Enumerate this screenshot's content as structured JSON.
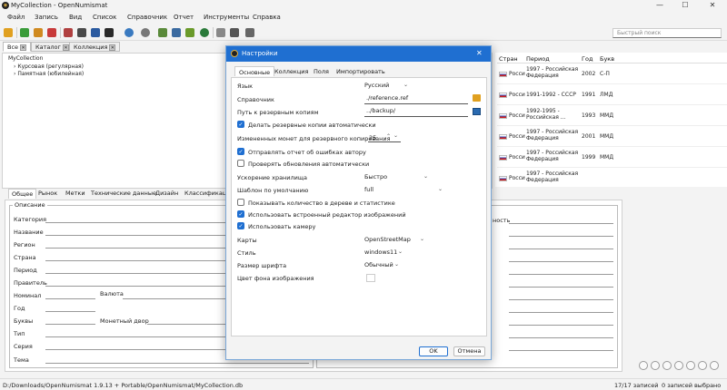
{
  "window": {
    "title": "MyCollection - OpenNumismat"
  },
  "menu": [
    "Файл",
    "Запись",
    "Вид",
    "Список",
    "Справочник",
    "Отчет",
    "Инструменты",
    "Справка"
  ],
  "quick_search_placeholder": "Быстрый поиск",
  "top_tabs": [
    "Все",
    "Каталог",
    "Коллекция"
  ],
  "tree": {
    "root": "MyCollection",
    "children": [
      "Курсовая (регулярная)",
      "Памятная (юбилейная)"
    ]
  },
  "grid": {
    "columns": [
      "Стран",
      "Период",
      "Год",
      "Букв"
    ],
    "rows": [
      {
        "country": "Росси",
        "period": "1997 - Российская Федерация",
        "year": "2002",
        "mint": "С-П"
      },
      {
        "country": "Росси",
        "period": "1991-1992 - СССР",
        "year": "1991",
        "mint": "ЛМД"
      },
      {
        "country": "Росси",
        "period": "1992-1995 - Российская ...",
        "year": "1993",
        "mint": "ММД"
      },
      {
        "country": "Росси",
        "period": "1997 - Российская Федерация",
        "year": "2001",
        "mint": "ММД"
      },
      {
        "country": "Росси",
        "period": "1997 - Российская Федерация",
        "year": "1999",
        "mint": "ММД"
      },
      {
        "country": "Росси",
        "period": "1997 - Российская Федерация",
        "year": "",
        "mint": ""
      }
    ]
  },
  "detail_tabs": [
    "Общее",
    "Рынок",
    "Метки",
    "Технические данные",
    "Дизайн",
    "Классификация"
  ],
  "detail_group_title": "Описание",
  "detail_fields": {
    "category": "Категория",
    "name": "Название",
    "region": "Регион",
    "country": "Страна",
    "period": "Период",
    "ruler": "Правитель",
    "nominal": "Номинал",
    "currency": "Валюта",
    "year": "Год",
    "letters": "Буквы",
    "mint": "Монетный двор",
    "type": "Тип",
    "series": "Серия",
    "theme": "Тема",
    "right_label": "ность"
  },
  "status": {
    "path": "D:/Downloads/OpenNumismat 1.9.13 + Portable/OpenNumismat/MyCollection.db",
    "count": "17/17 записей",
    "selected": "0 записей выбрано"
  },
  "dialog": {
    "title": "Настройки",
    "tabs": [
      "Основные",
      "Коллекция",
      "Поля",
      "Импортировать"
    ],
    "language_label": "Язык",
    "language_value": "Русский",
    "reference_label": "Справочник",
    "reference_value": "./reference.ref",
    "backup_path_label": "Путь к резервным копиям",
    "backup_path_value": "../backup/",
    "make_backups": "Делать резервные копии автоматически",
    "changed_coins_label": "Измененных монет для резервного копирования",
    "changed_coins_value": "25",
    "send_errors": "Отправлять отчет об ошибках автору",
    "check_updates": "Проверять обновления автоматически",
    "storage_accel_label": "Ускорение хранилища",
    "storage_accel_value": "Быстро",
    "template_label": "Шаблон по умолчанию",
    "template_value": "full",
    "show_count": "Показывать количество в дереве и статистике",
    "builtin_editor": "Использовать встроенный редактор изображений",
    "use_camera": "Использовать камеру",
    "maps_label": "Карты",
    "maps_value": "OpenStreetMap",
    "style_label": "Стиль",
    "style_value": "windows11",
    "font_size_label": "Размер шрифта",
    "font_size_value": "Обычный",
    "bg_color_label": "Цвет фона изображения",
    "ok": "OK",
    "cancel": "Отмена"
  }
}
